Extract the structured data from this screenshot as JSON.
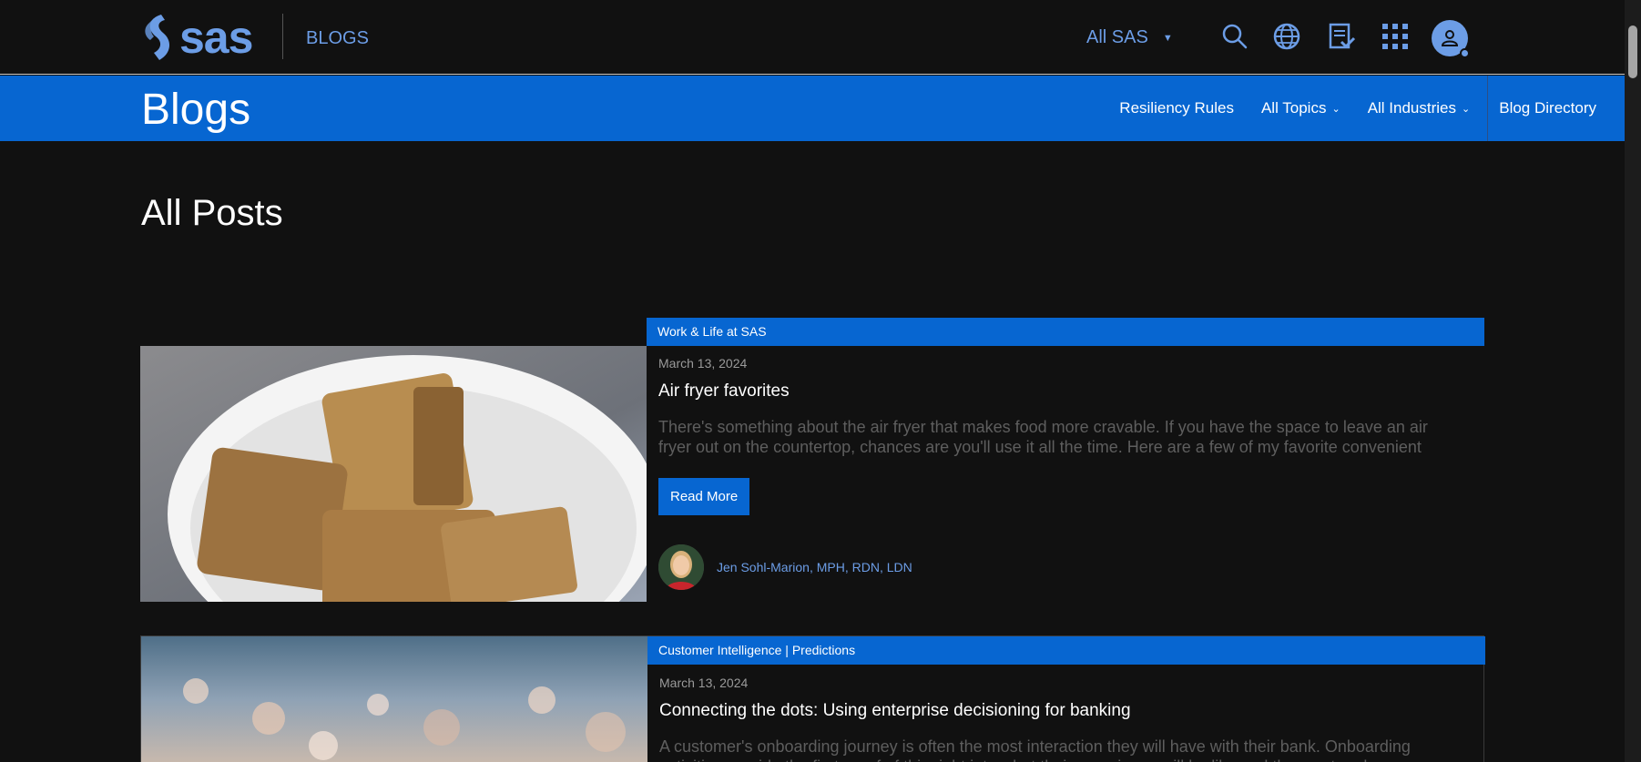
{
  "header": {
    "logo_text": "sas",
    "blogs_link": "BLOGS",
    "scope_label": "All SAS",
    "icons": [
      "search-icon",
      "globe-icon",
      "contact-form-icon",
      "apps-grid-icon",
      "user-avatar-icon"
    ],
    "accent": "#6c9de6"
  },
  "nav": {
    "title": "Blogs",
    "items": [
      {
        "label": "Resiliency Rules"
      },
      {
        "label": "All Topics"
      },
      {
        "label": "All Industries"
      },
      {
        "label": "Blog Directory"
      }
    ],
    "background": "#0766d1"
  },
  "main": {
    "title": "All Posts",
    "posts": [
      {
        "category": "Work & Life at SAS",
        "date": "March 13, 2024",
        "title": "Air fryer favorites",
        "excerpt": "There's something about the air fryer that makes food more cravable. If you have the space to leave an air fryer out on the countertop, chances are you'll use it all the time. Here are a few of my favorite convenient",
        "read_more": "Read More",
        "author": "Jen Sohl-Marion, MPH, RDN, LDN"
      },
      {
        "category": "Customer Intelligence | Predictions",
        "date": "March 13, 2024",
        "title": "Connecting the dots: Using enterprise decisioning for banking",
        "excerpt": "A customer's onboarding journey is often the most interaction they will have with their bank. Onboarding activities provide the first proof of this right into what their experience will be like and the most and"
      }
    ]
  }
}
